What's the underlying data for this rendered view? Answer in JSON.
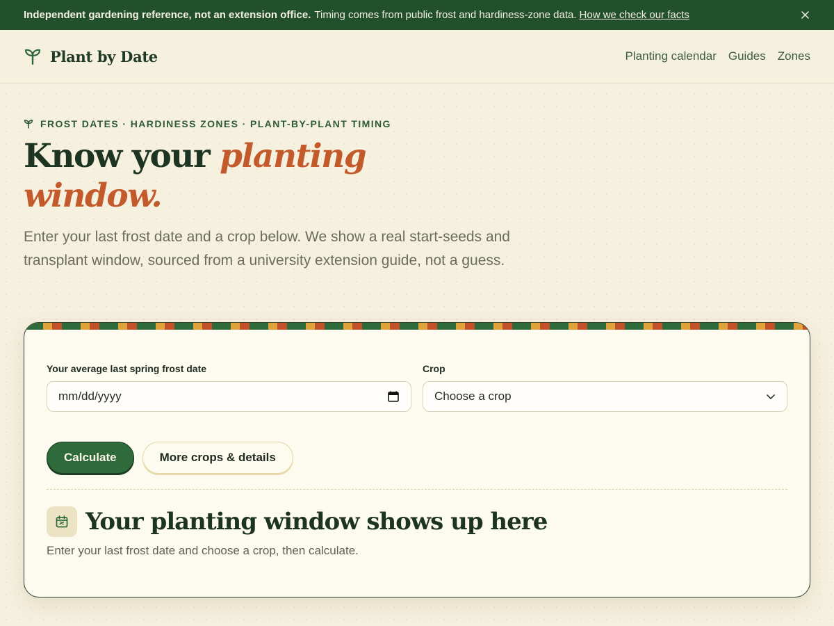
{
  "banner": {
    "bold": "Independent gardening reference, not an extension office.",
    "text": "Timing comes from public frost and hardiness-zone data.",
    "link": "How we check our facts"
  },
  "nav": {
    "brand": "Plant by Date",
    "links": [
      "Planting calendar",
      "Guides",
      "Zones"
    ]
  },
  "hero": {
    "eyebrow": "Frost dates · Hardiness zones · Plant-by-plant timing",
    "title_plain": "Know your",
    "title_accent": "planting window.",
    "lead": "Enter your last frost date and a crop below. We show a real start-seeds and transplant window, sourced from a university extension guide, not a guess."
  },
  "form": {
    "date_label": "Your average last spring frost date",
    "date_placeholder": "mm/dd/yyyy",
    "crop_label": "Crop",
    "crop_selected": "Choose a crop",
    "calculate": "Calculate",
    "more": "More crops & details"
  },
  "result": {
    "title": "Your planting window shows up here",
    "subtitle": "Enter your last frost date and choose a crop, then calculate."
  },
  "colors": {
    "brand_green": "#22502b",
    "accent_orange": "#c35a2c",
    "gold": "#e0a23a"
  }
}
